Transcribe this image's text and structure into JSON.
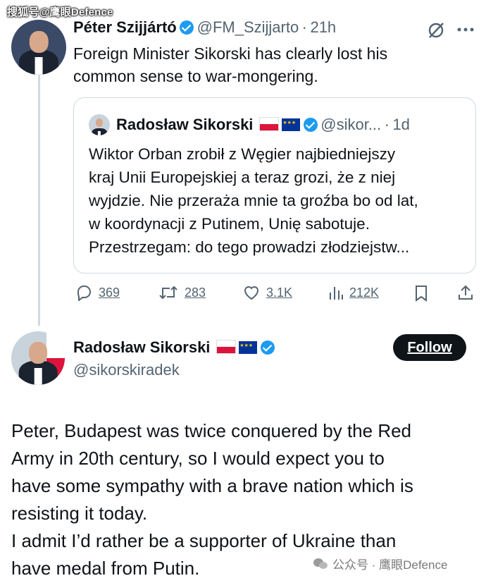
{
  "watermark_top": "搜狐号@鹰眼Defence",
  "reply_tweet": {
    "author_name": "Péter Szijjártó",
    "author_handle": "@FM_Szijjarto",
    "separator": "·",
    "time": "21h",
    "text_lines": [
      "Foreign Minister Sikorski has clearly lost his",
      "common sense to war-mongering."
    ],
    "quoted": {
      "author_name": "Radosław Sikorski",
      "author_handle": "@sikor...",
      "separator": "·",
      "time": "1d",
      "text_lines": [
        "Wiktor Orban zrobił z Węgier najbiedniejszy",
        "kraj Unii Europejskiej a teraz grozi, że z niej",
        "wyjdzie. Nie przeraża mnie ta groźba bo od lat,",
        "w koordynacji z Putinem, Unię sabotuje.",
        "Przestrzegam: do tego prowadzi złodziejstw..."
      ]
    },
    "actions": {
      "replies": "369",
      "retweets": "283",
      "likes": "3.1K",
      "views": "212K"
    }
  },
  "main_tweet": {
    "author_name": "Radosław Sikorski",
    "author_handle": "@sikorskiradek",
    "follow_label": "Follow",
    "text_lines": [
      "Peter, Budapest was twice conquered by the Red",
      "Army in 20th century, so I would expect you to",
      "have some sympathy with a brave nation which is",
      "resisting it today.",
      "I admit I’d rather be a supporter of Ukraine than",
      "have medal from Putin."
    ]
  },
  "watermark_bottom": "公众号 · 鹰眼Defence",
  "colors": {
    "text": "#0f1419",
    "secondary": "#536471",
    "verified": "#1d9bf0",
    "border": "#cfd9de",
    "follow_bg": "#0f1419"
  }
}
